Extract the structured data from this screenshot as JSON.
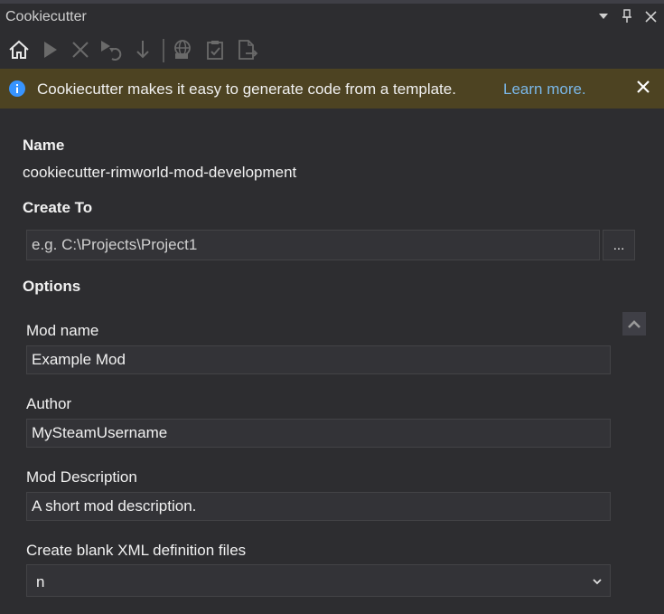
{
  "window": {
    "title": "Cookiecutter"
  },
  "infobar": {
    "message": "Cookiecutter makes it easy to generate code from a template.",
    "link": "Learn more."
  },
  "name_section": {
    "label": "Name",
    "value": "cookiecutter-rimworld-mod-development"
  },
  "create_to": {
    "label": "Create To",
    "placeholder": "e.g. C:\\Projects\\Project1",
    "browse_label": "..."
  },
  "options": {
    "label": "Options",
    "fields": [
      {
        "label": "Mod name",
        "value": "Example Mod"
      },
      {
        "label": "Author",
        "value": "MySteamUsername"
      },
      {
        "label": "Mod Description",
        "value": "A short mod description."
      },
      {
        "label": "Create blank XML definition files",
        "value": "n"
      }
    ]
  },
  "colors": {
    "background": "#2d2d30",
    "infobar_background": "#4d4322",
    "link": "#7ab7e8",
    "info_icon": "#3794ff",
    "input_background": "#333337"
  }
}
